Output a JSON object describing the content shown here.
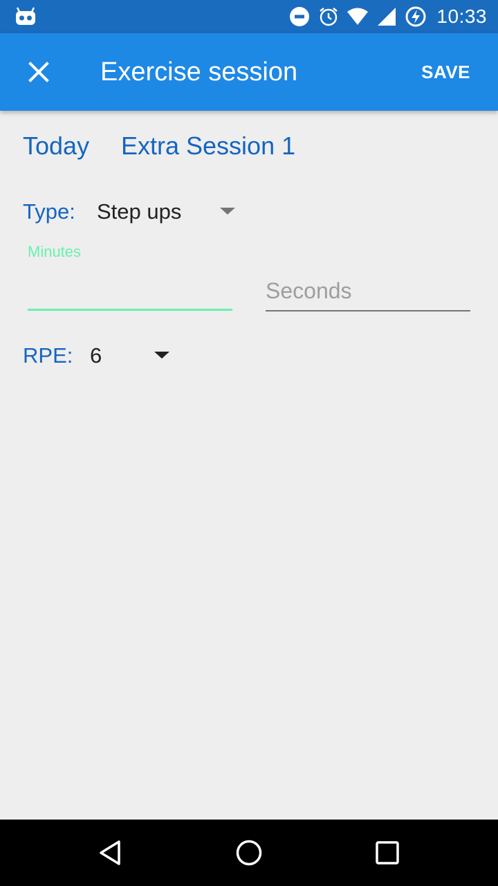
{
  "status_bar": {
    "time": "10:33",
    "icons": [
      "notification-app-icon",
      "do-not-disturb-icon",
      "alarm-icon",
      "wifi-icon",
      "cell-signal-icon",
      "battery-charging-icon"
    ]
  },
  "app_bar": {
    "title": "Exercise session",
    "save_label": "SAVE",
    "close_icon": "close-icon"
  },
  "session": {
    "date_label": "Today",
    "session_label": "Extra Session 1"
  },
  "form": {
    "type_label": "Type:",
    "type_value": "Step ups",
    "minutes_label": "Minutes",
    "minutes_value": "",
    "seconds_placeholder": "Seconds",
    "seconds_value": "",
    "rpe_label": "RPE:",
    "rpe_value": "6"
  },
  "nav_bar": {
    "icons": [
      "back-icon",
      "home-icon",
      "recents-icon"
    ]
  },
  "colors": {
    "status_bar": "#1a6cbf",
    "app_bar": "#1e88e5",
    "label_blue": "#1565c0",
    "accent_green": "#69f0ae",
    "background": "#eeeeee"
  }
}
